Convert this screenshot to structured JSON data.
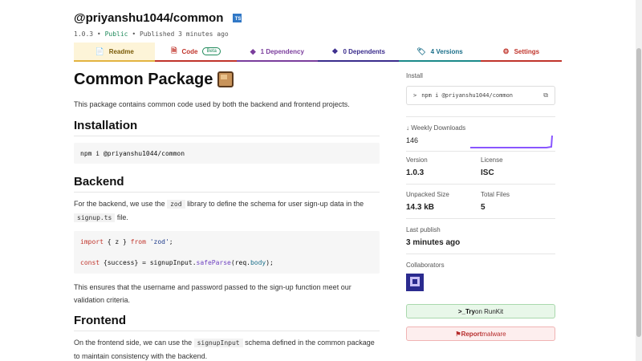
{
  "package": {
    "name": "@priyanshu1044/common",
    "ts_badge": "TS",
    "version": "1.0.3",
    "sep1": "•",
    "visibility": "Public",
    "sep2": "•",
    "published": "Published 3 minutes ago"
  },
  "tabs": [
    {
      "label": "Readme",
      "icon": "📄"
    },
    {
      "label": "Code",
      "icon": "🗎",
      "badge": "Beta"
    },
    {
      "label": "1 Dependency",
      "icon": "◆"
    },
    {
      "label": "0 Dependents",
      "icon": "❖"
    },
    {
      "label": "4 Versions",
      "icon": "🏷"
    },
    {
      "label": "Settings",
      "icon": "⚙"
    }
  ],
  "readme": {
    "title": "Common Package",
    "intro": "This package contains common code used by both the backend and frontend projects.",
    "installation_heading": "Installation",
    "install_cmd": "npm i @priyanshu1044/common",
    "backend_heading": "Backend",
    "backend_p1": "For the backend, we use the",
    "backend_code1": "zod",
    "backend_p2": "library to define the schema for user sign-up data in the",
    "backend_code2": "signup.ts",
    "backend_p3": "file.",
    "code_line1": {
      "kw": "import",
      "mid": " { z } ",
      "kw2": "from",
      "str": " 'zod'",
      "end": ";"
    },
    "code_line2": {
      "kw": "const",
      "mid": " {success} = signupInput.",
      "fn": "safeParse",
      "mid2": "(req.",
      "prop": "body",
      "end": ");"
    },
    "backend_after": "This ensures that the username and password passed to the sign-up function meet our validation criteria.",
    "frontend_heading": "Frontend",
    "frontend_p1": "On the frontend side, we can use the",
    "frontend_code": "signupInput",
    "frontend_p2": "schema defined in the common package to maintain consistency with the backend."
  },
  "sidebar": {
    "install_label": "Install",
    "install_prompt": ">",
    "install_cmd": "npm i @priyanshu1044/common",
    "copy_icon": "⧉",
    "weekly_label": "Weekly Downloads",
    "weekly_icon": "↓",
    "weekly_value": "146",
    "version_label": "Version",
    "version_value": "1.0.3",
    "license_label": "License",
    "license_value": "ISC",
    "unpacked_label": "Unpacked Size",
    "unpacked_value": "14.3 kB",
    "files_label": "Total Files",
    "files_value": "5",
    "last_publish_label": "Last publish",
    "last_publish_value": "3 minutes ago",
    "collaborators_label": "Collaborators",
    "runkit_icon": ">_",
    "runkit_bold": "Try",
    "runkit_rest": " on RunKit",
    "report_icon": "⚑",
    "report_bold": "Report",
    "report_rest": " malware"
  },
  "colors": {
    "sparkline": "#8956ff",
    "public": "#1f8a5b"
  }
}
